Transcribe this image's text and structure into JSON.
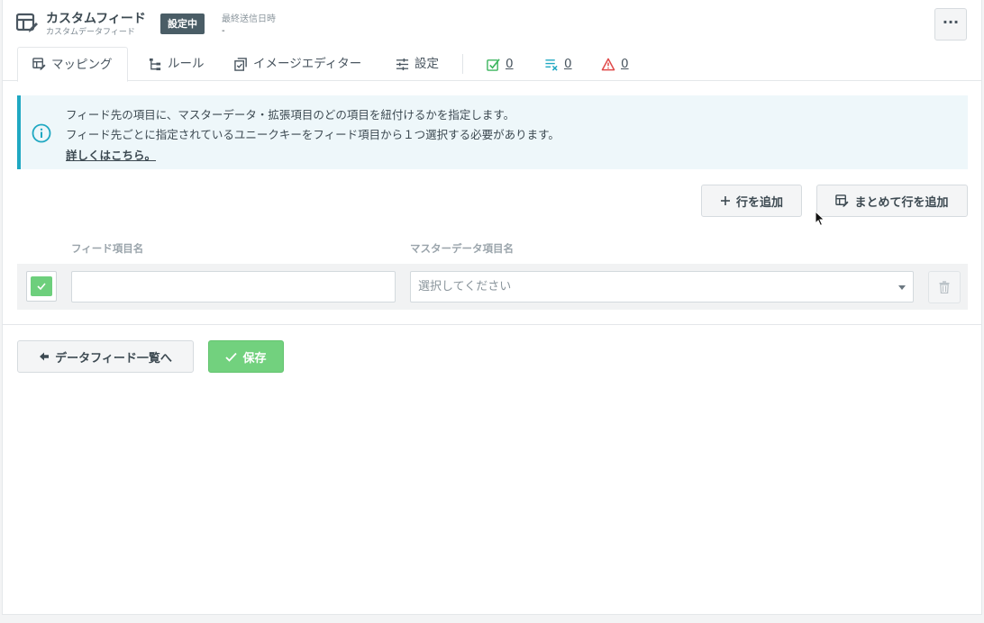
{
  "header": {
    "title": "カスタムフィード",
    "subtitle": "カスタムデータフィード",
    "status_badge": "設定中",
    "last_sent_label": "最終送信日時",
    "last_sent_value": "-",
    "more_label": "···"
  },
  "tabs": [
    {
      "label": "マッピング",
      "icon": "mapping-icon",
      "active": true
    },
    {
      "label": "ルール",
      "icon": "rule-tree-icon"
    },
    {
      "label": "イメージエディター",
      "icon": "image-editor-icon"
    },
    {
      "label": "設定",
      "icon": "sliders-icon"
    }
  ],
  "counters": [
    {
      "icon": "check-list-icon",
      "value": "0",
      "color": "#3cb55e"
    },
    {
      "icon": "error-list-icon",
      "value": "0",
      "color": "#1fa8c2"
    },
    {
      "icon": "warning-icon",
      "value": "0",
      "color": "#e04a4a"
    }
  ],
  "info": {
    "line1": "フィード先の項目に、マスターデータ・拡張項目のどの項目を紐付けるかを指定します。",
    "line2": "フィード先ごとに指定されているユニークキーをフィード項目から１つ選択する必要があります。",
    "link": "詳しくはこちら。",
    "accent_color": "#1fa8c2"
  },
  "actions": {
    "add_row": "行を追加",
    "bulk_add_row": "まとめて行を追加"
  },
  "table": {
    "col_feed_item": "フィード項目名",
    "col_master_item": "マスターデータ項目名",
    "rows": [
      {
        "checked": true,
        "feed_item_value": "",
        "master_item_placeholder": "選択してください"
      }
    ]
  },
  "footer": {
    "back_label": "データフィード一覧へ",
    "save_label": "保存",
    "save_color": "#72d17e"
  }
}
